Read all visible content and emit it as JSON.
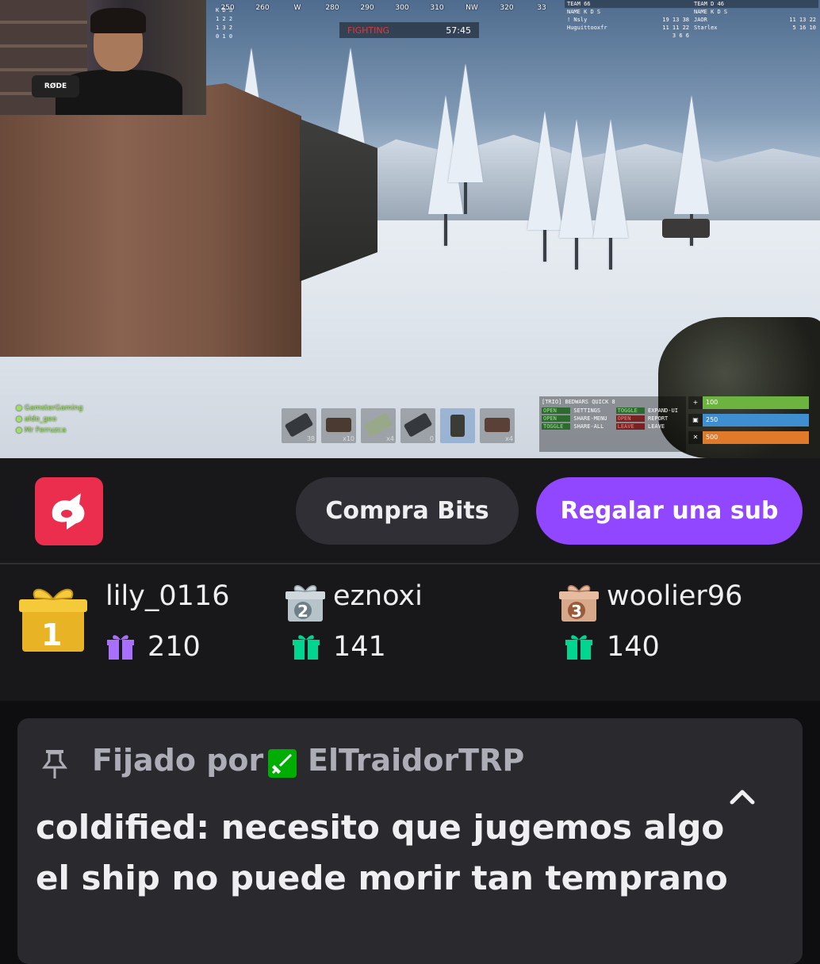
{
  "game_hud": {
    "compass": [
      "250",
      "260",
      "W",
      "280",
      "290",
      "300",
      "310",
      "NW",
      "320",
      "33"
    ],
    "fight_label": "FIGHTING",
    "fight_timer": "57:45",
    "kds_left": {
      "header": "K  D  S",
      "rows": [
        "1  2  2",
        "1  3  2",
        "0  1  0"
      ]
    },
    "teams": [
      {
        "title": "TEAM",
        "score": "66",
        "header": "NAME          K  D  S",
        "rows": [
          {
            "name": "! Nsly",
            "stats": "19 13 38"
          },
          {
            "name": "Huguittooxfr",
            "stats": "11 11 22"
          },
          {
            "name": "",
            "stats": "3  6  6"
          }
        ]
      },
      {
        "title": "TEAM D",
        "score": "46",
        "header": "NAME          K  D  S",
        "rows": [
          {
            "name": "JAOR",
            "stats": "11 13 22"
          },
          {
            "name": "Starlex",
            "stats": "5  16 10"
          }
        ]
      }
    ],
    "player_names": [
      "GamsterGaming",
      "aldo_geo",
      "Mr Ferruzca"
    ],
    "hotbar_counts": [
      "38",
      "x10",
      "x4",
      "0",
      "",
      "x4"
    ],
    "bedwars": {
      "title": "[TRIO] BEDWARS QUICK 8",
      "cells": [
        "OPEN",
        "SETTINGS",
        "TOGGLE",
        "EXPAND-UI",
        "OPEN",
        "SHARE-MENU",
        "OPEN",
        "REPORT",
        "TOGGLE",
        "SHARE-ALL",
        "LEAVE",
        "LEAVE"
      ]
    },
    "stats": [
      {
        "icon": "+",
        "value": "100",
        "color": "#6db33f"
      },
      {
        "icon": "▣",
        "value": "250",
        "color": "#3f8fd0"
      },
      {
        "icon": "✕",
        "value": "500",
        "color": "#e07a2a"
      }
    ]
  },
  "webcam": {
    "mic_brand": "RØDE"
  },
  "actions": {
    "bits_label": "Compra Bits",
    "gift_label": "Regalar una sub"
  },
  "leaderboard": [
    {
      "rank": "1",
      "name": "lily_0116",
      "count": "210",
      "gift_color": "#a970ff"
    },
    {
      "rank": "2",
      "name": "eznoxi",
      "count": "141",
      "gift_color": "#00d68f"
    },
    {
      "rank": "3",
      "name": "woolier96",
      "count": "140",
      "gift_color": "#00d68f"
    }
  ],
  "pinned": {
    "label": "Fijado por",
    "pinned_by": "ElTraidorTRP",
    "message": "coldified: necesito que jugemos algo el ship no puede morir tan temprano"
  }
}
